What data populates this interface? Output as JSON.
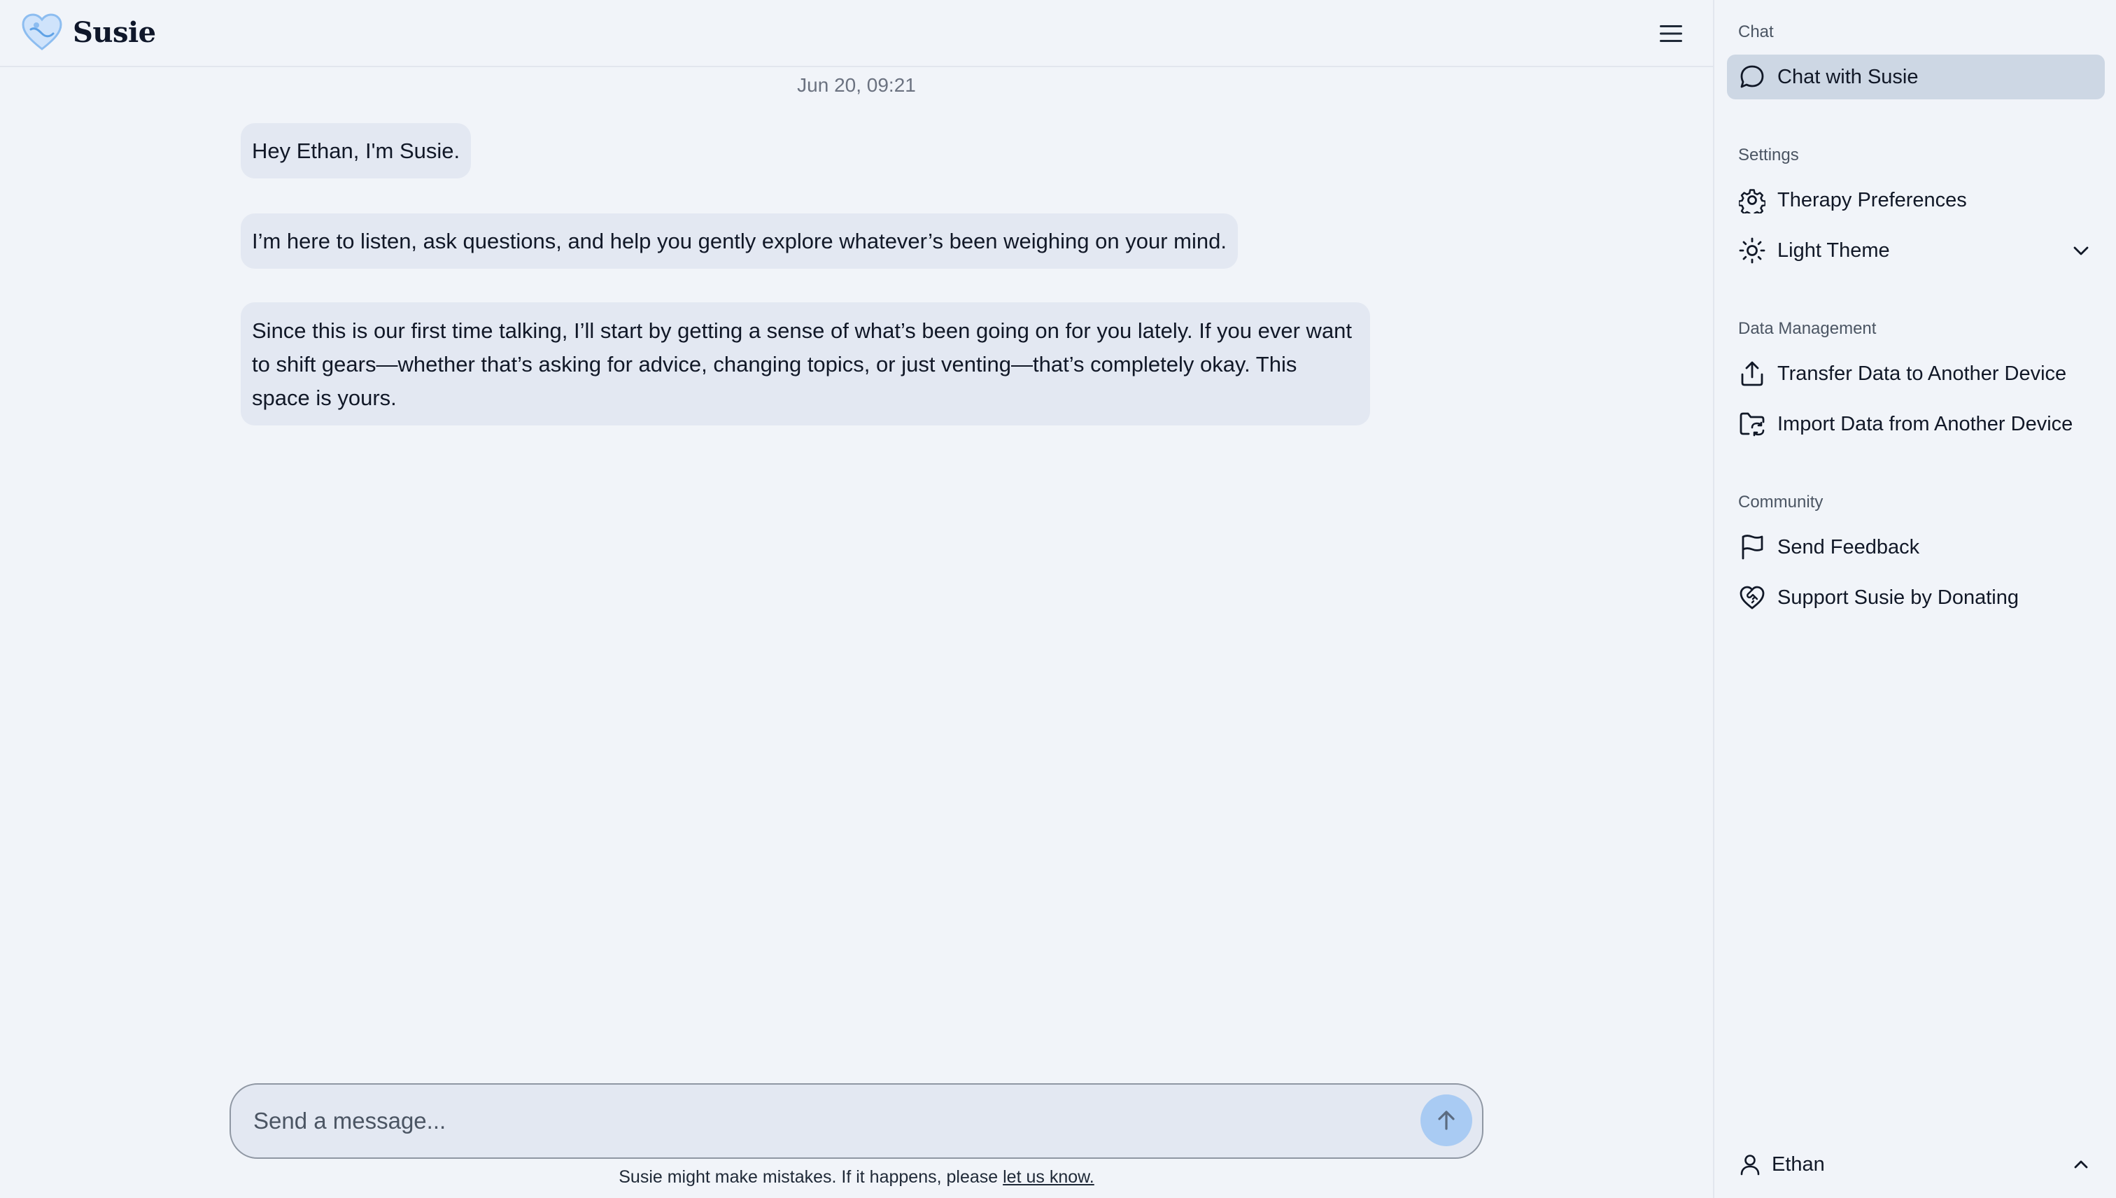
{
  "app": {
    "name": "Susie"
  },
  "header": {
    "menu_icon": "hamburger-menu-icon"
  },
  "chat": {
    "timestamp": "Jun 20, 09:21",
    "messages": [
      {
        "text": "Hey Ethan, I'm Susie."
      },
      {
        "text": "I’m here to listen, ask questions, and help you gently explore whatever’s been weighing on your mind."
      },
      {
        "text": "Since this is our first time talking, I’ll start by getting a sense of what’s been going on for you lately. If you ever want to shift gears—whether that’s asking for advice, changing topics, or just venting—that’s completely okay. This space is yours."
      }
    ],
    "composer": {
      "placeholder": "Send a message...",
      "value": ""
    },
    "disclaimer": {
      "text": "Susie might make mistakes. If it happens, please ",
      "link": "let us know."
    }
  },
  "sidebar": {
    "sections": [
      {
        "label": "Chat",
        "items": [
          {
            "label": "Chat with Susie",
            "icon": "chat-bubble-icon",
            "active": true
          }
        ]
      },
      {
        "label": "Settings",
        "items": [
          {
            "label": "Therapy Preferences",
            "icon": "gear-icon"
          },
          {
            "label": "Light Theme",
            "icon": "sun-icon",
            "dropdown": true
          }
        ]
      },
      {
        "label": "Data Management",
        "items": [
          {
            "label": "Transfer Data to Another Device",
            "icon": "upload-icon"
          },
          {
            "label": "Import Data from Another Device",
            "icon": "folder-sync-icon"
          }
        ]
      },
      {
        "label": "Community",
        "items": [
          {
            "label": "Send Feedback",
            "icon": "flag-icon"
          },
          {
            "label": "Support Susie by Donating",
            "icon": "heart-handshake-icon"
          }
        ]
      }
    ],
    "user": {
      "name": "Ethan",
      "icon": "user-icon"
    }
  },
  "colors": {
    "accent": "#a9cbf3",
    "bubble": "#e3e8f2",
    "active_nav": "#cdd7e4",
    "background": "#f1f4f9"
  }
}
